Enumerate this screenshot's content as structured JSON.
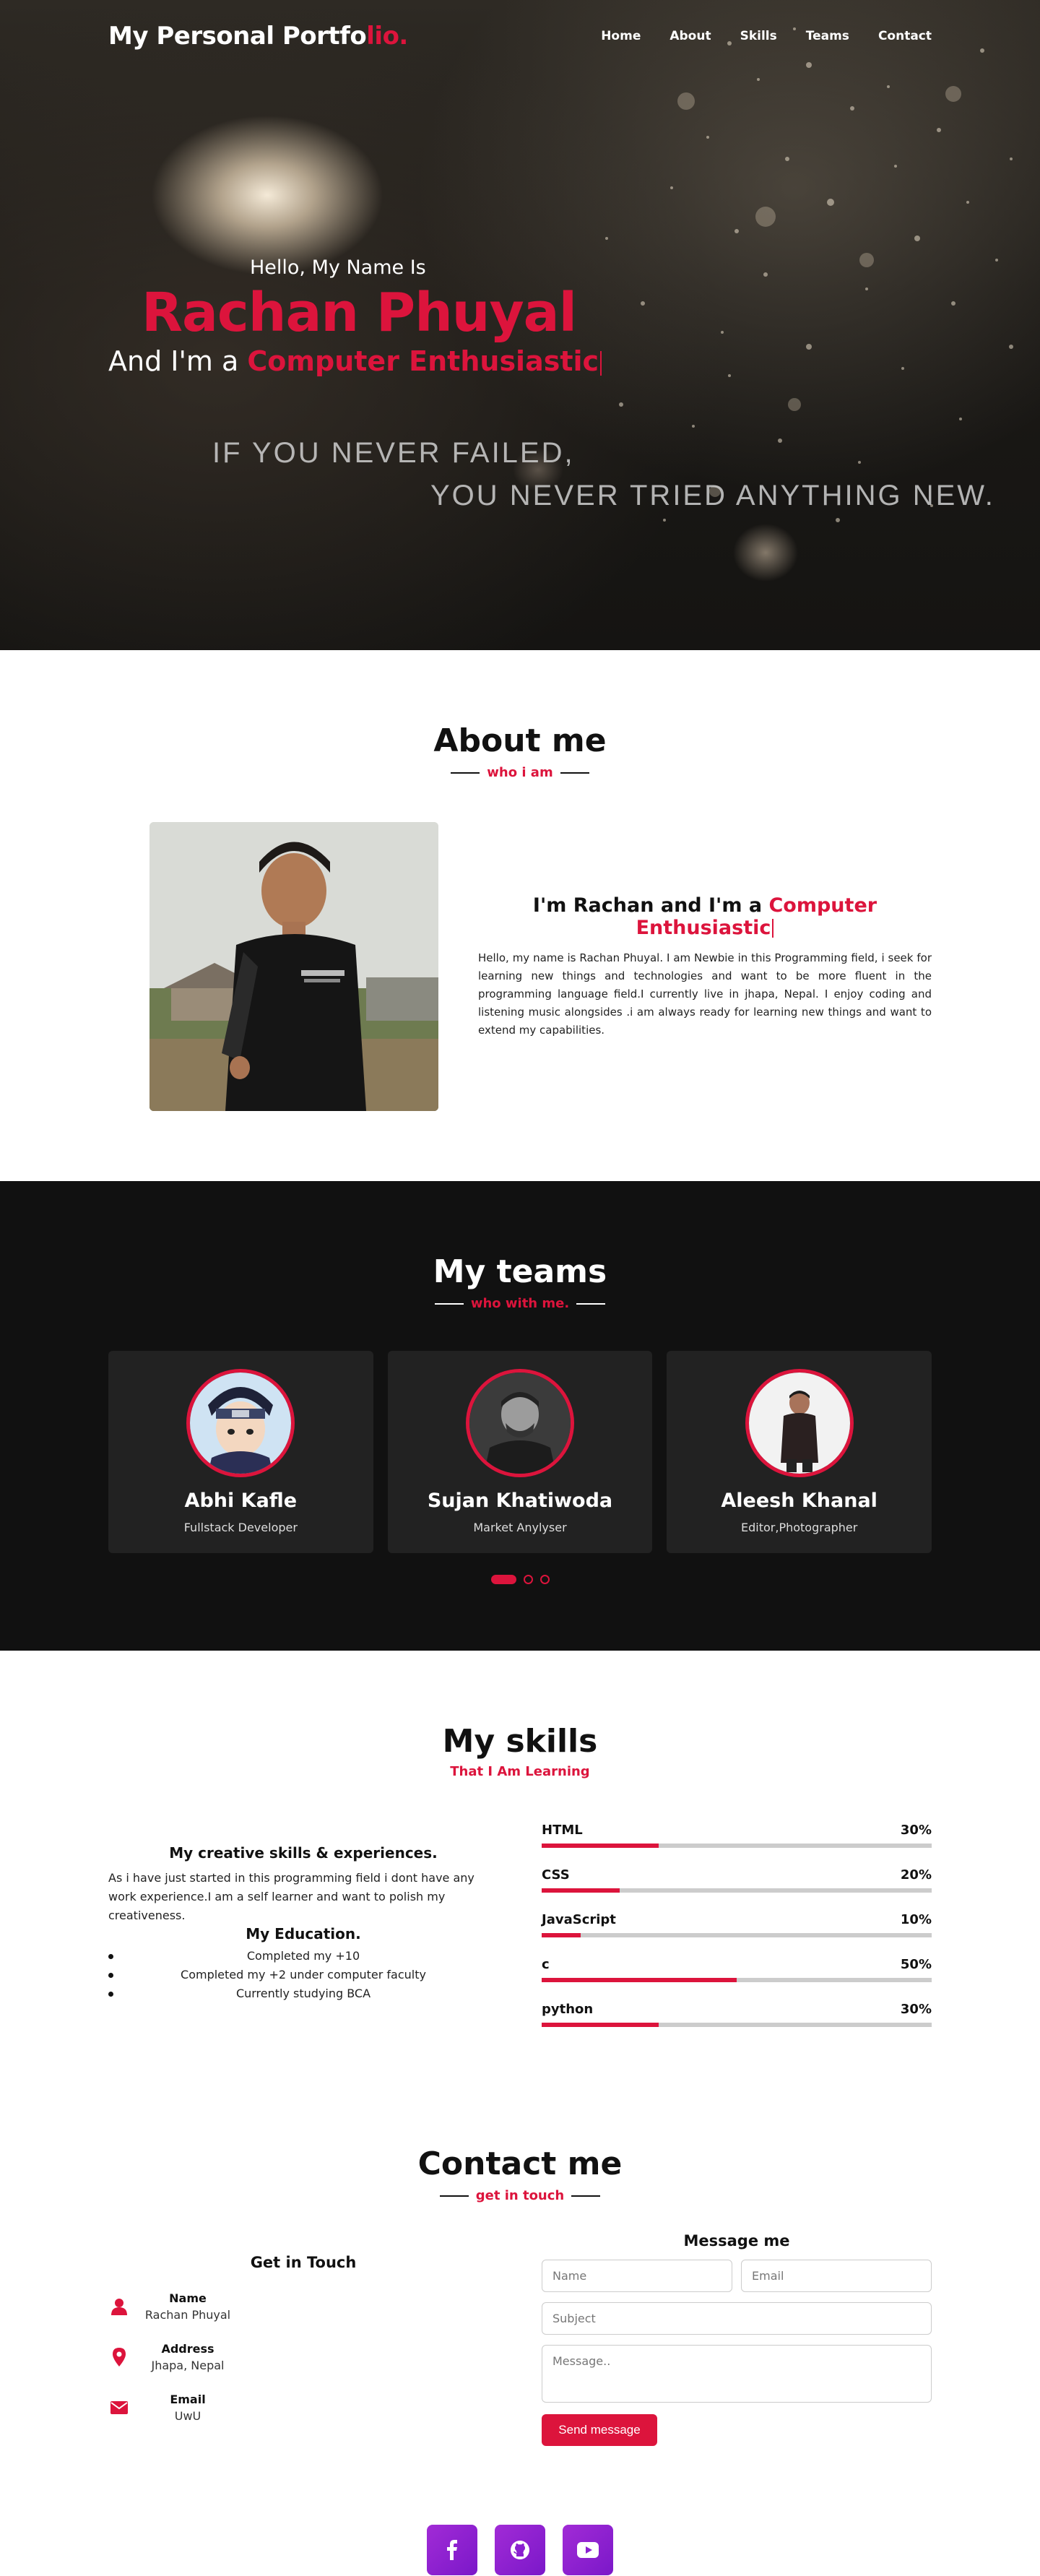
{
  "nav": {
    "logo_main": "My Personal Portfo",
    "logo_accent": "lio.",
    "items": [
      "Home",
      "About",
      "Skills",
      "Teams",
      "Contact"
    ]
  },
  "hero": {
    "greeting": "Hello, My Name Is",
    "name": "Rachan Phuyal",
    "role_prefix": "And I'm a ",
    "role_typed": "Computer Enthusiastic",
    "quote_line1": "IF YOU NEVER FAILED,",
    "quote_line2": "YOU NEVER TRIED ANYTHING NEW."
  },
  "about": {
    "title": "About me",
    "subtitle": "who i am",
    "heading_prefix": "I'm Rachan and I'm a ",
    "heading_accent": "Computer Enthusiastic",
    "text": "Hello, my name is Rachan Phuyal. I am Newbie in this Programming field, i seek for learning new things and technologies and want to be more fluent in the programming language field.I currently live in jhapa, Nepal. I enjoy coding and listening music alongsides .i am always ready for learning new things and want to extend my capabilities."
  },
  "teams": {
    "title": "My teams",
    "subtitle": "who with me.",
    "members": [
      {
        "name": "Abhi Kafle",
        "position": "Fullstack Developer"
      },
      {
        "name": "Sujan Khatiwoda",
        "position": "Market Anylyser"
      },
      {
        "name": "Aleesh Khanal",
        "position": "Editor,Photographer"
      }
    ]
  },
  "skills": {
    "title": "My skills",
    "subtitle": "That I Am Learning",
    "creative_heading": "My creative skills & experiences.",
    "creative_text": "As i have just started in this programming field i dont have any work experience.I am a self learner and want to polish my creativeness.",
    "education_heading": "My Education.",
    "education": [
      "Completed my +10",
      "Completed my +2 under computer faculty",
      "Currently studying BCA"
    ],
    "bars": [
      {
        "name": "HTML",
        "label": "30%",
        "value": 30
      },
      {
        "name": "CSS",
        "label": "20%",
        "value": 20
      },
      {
        "name": "JavaScript",
        "label": "10%",
        "value": 10
      },
      {
        "name": "c",
        "label": "50%",
        "value": 50
      },
      {
        "name": "python",
        "label": "30%",
        "value": 30
      }
    ]
  },
  "contact": {
    "title": "Contact me",
    "subtitle": "get in touch",
    "left_heading": "Get in Touch",
    "info": [
      {
        "head": "Name",
        "value": "Rachan Phuyal"
      },
      {
        "head": "Address",
        "value": "Jhapa, Nepal"
      },
      {
        "head": "Email",
        "value": "UwU"
      }
    ],
    "right_heading": "Message me",
    "placeholders": {
      "name": "Name",
      "email": "Email",
      "subject": "Subject",
      "message": "Message.."
    },
    "send_label": "Send message"
  },
  "social": [
    "facebook-icon",
    "github-icon",
    "youtube-icon"
  ],
  "colors": {
    "accent": "#dc143c",
    "dark": "#111111",
    "card": "#222222",
    "social": "#8a1fd0"
  }
}
